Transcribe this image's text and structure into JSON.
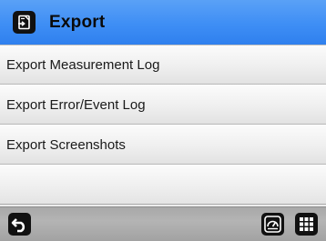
{
  "header": {
    "title": "Export",
    "icon": "export-document-icon"
  },
  "menu": {
    "items": [
      {
        "label": "Export Measurement Log"
      },
      {
        "label": "Export Error/Event Log"
      },
      {
        "label": "Export Screenshots"
      }
    ]
  },
  "footer": {
    "back_icon": "back-arrow-icon",
    "meter_icon": "meter-gauge-icon",
    "apps_icon": "apps-grid-icon"
  },
  "colors": {
    "header_blue": "#3e8ef5",
    "icon_bg": "#111111"
  }
}
